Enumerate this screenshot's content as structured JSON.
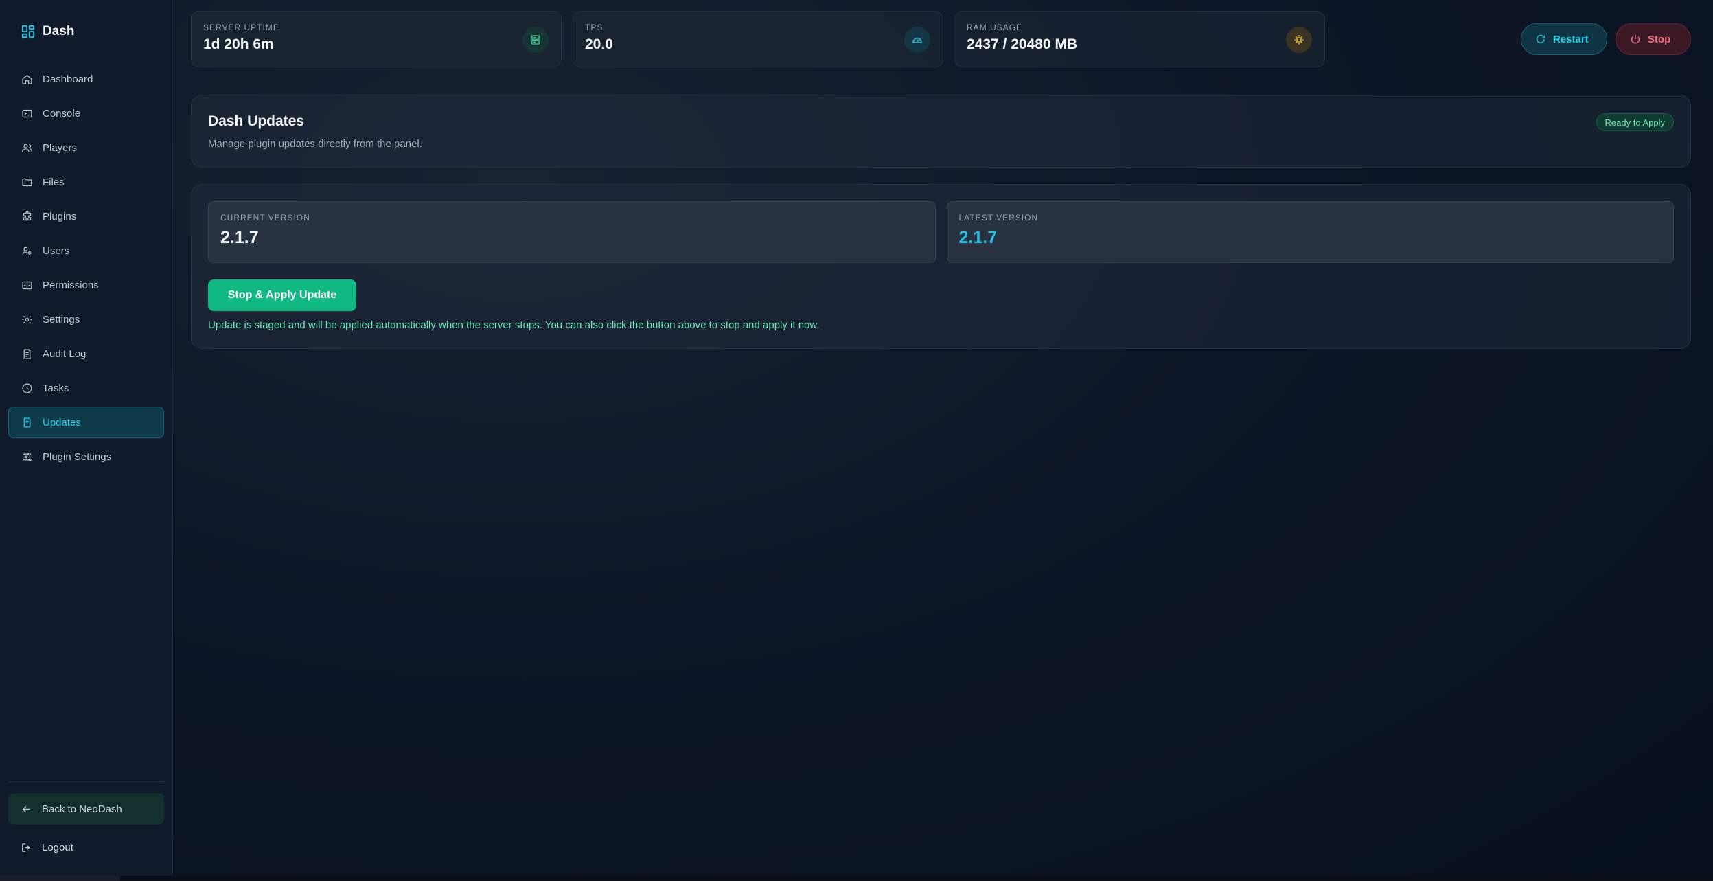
{
  "app": {
    "name": "Dash"
  },
  "sidebar": {
    "items": [
      {
        "label": "Dashboard",
        "icon": "home-icon"
      },
      {
        "label": "Console",
        "icon": "terminal-icon"
      },
      {
        "label": "Players",
        "icon": "players-icon"
      },
      {
        "label": "Files",
        "icon": "folder-icon"
      },
      {
        "label": "Plugins",
        "icon": "puzzle-icon"
      },
      {
        "label": "Users",
        "icon": "users-icon"
      },
      {
        "label": "Permissions",
        "icon": "book-icon"
      },
      {
        "label": "Settings",
        "icon": "gear-icon"
      },
      {
        "label": "Audit Log",
        "icon": "log-icon"
      },
      {
        "label": "Tasks",
        "icon": "clock-icon"
      },
      {
        "label": "Updates",
        "icon": "update-icon",
        "active": true
      },
      {
        "label": "Plugin Settings",
        "icon": "sliders-icon"
      }
    ],
    "back_label": "Back to NeoDash",
    "logout_label": "Logout"
  },
  "stats": [
    {
      "label": "SERVER UPTIME",
      "value": "1d 20h 6m",
      "icon": "server-icon"
    },
    {
      "label": "TPS",
      "value": "20.0",
      "icon": "gauge-icon"
    },
    {
      "label": "RAM USAGE",
      "value": "2437 / 20480 MB",
      "icon": "chip-icon"
    }
  ],
  "actions": {
    "restart_label": "Restart",
    "stop_label": "Stop"
  },
  "updates": {
    "title": "Dash Updates",
    "subtitle": "Manage plugin updates directly from the panel.",
    "badge": "Ready to Apply",
    "current_label": "CURRENT VERSION",
    "current_value": "2.1.7",
    "latest_label": "LATEST VERSION",
    "latest_value": "2.1.7",
    "apply_label": "Stop & Apply Update",
    "note": "Update is staged and will be applied automatically when the server stops. You can also click the button above to stop and apply it now."
  },
  "colors": {
    "accent": "#22d3ee",
    "success": "#10b981",
    "danger": "#f87189",
    "warning": "#facc15"
  }
}
